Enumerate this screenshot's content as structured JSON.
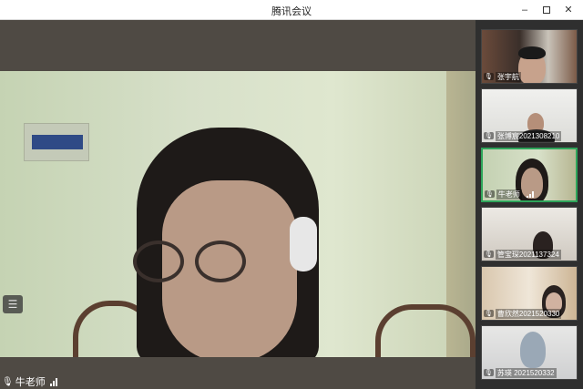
{
  "window": {
    "title": "腾讯会议",
    "minimize_glyph": "–",
    "close_glyph": "✕"
  },
  "main_video": {
    "speaker_name": "牛老师",
    "list_icon_glyph": "☰"
  },
  "participants": [
    {
      "name": "张宇航"
    },
    {
      "name": "张博宸2021308210"
    },
    {
      "name": "牛老师"
    },
    {
      "name": "管宝琛2021137324"
    },
    {
      "name": "曹欣然2021520330"
    },
    {
      "name": "苏瑛 2021520332"
    }
  ],
  "icons": {
    "mic": "🎙"
  }
}
